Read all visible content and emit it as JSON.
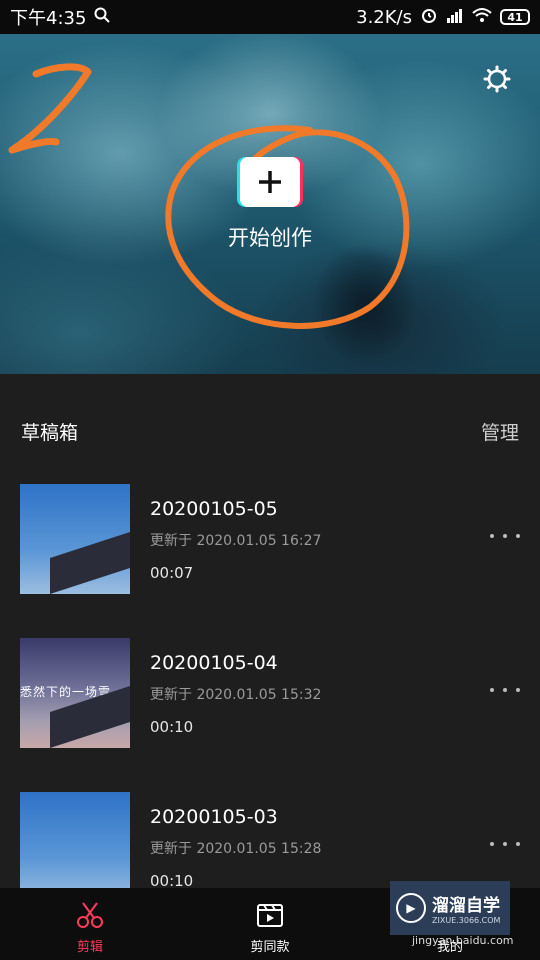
{
  "status_bar": {
    "time": "下午4:35",
    "network_speed": "3.2K/s",
    "battery": "41"
  },
  "hero": {
    "create_label": "开始创作",
    "create_icon": "plus-icon",
    "settings_icon": "gear-icon",
    "annotation_color": "#f07a2a"
  },
  "drafts": {
    "title": "草稿箱",
    "manage_label": "管理",
    "items": [
      {
        "name": "20200105-05",
        "updated": "更新于 2020.01.05 16:27",
        "duration": "00:07",
        "thumb_caption": ""
      },
      {
        "name": "20200105-04",
        "updated": "更新于 2020.01.05 15:32",
        "duration": "00:10",
        "thumb_caption": "悉然下的一场雪"
      },
      {
        "name": "20200105-03",
        "updated": "更新于 2020.01.05 15:28",
        "duration": "00:10",
        "thumb_caption": ""
      }
    ]
  },
  "bottom_nav": {
    "items": [
      {
        "label": "剪辑",
        "icon": "scissors-icon",
        "active": true
      },
      {
        "label": "剪同款",
        "icon": "clapperboard-icon",
        "active": false
      },
      {
        "label": "我的",
        "icon": "user-icon",
        "active": false
      }
    ],
    "active_color": "#ff3b5c"
  },
  "watermark": {
    "brand": "溜溜自学",
    "domain": "ZIXUE.3066.COM",
    "url": "jingyan.baidu.com"
  }
}
